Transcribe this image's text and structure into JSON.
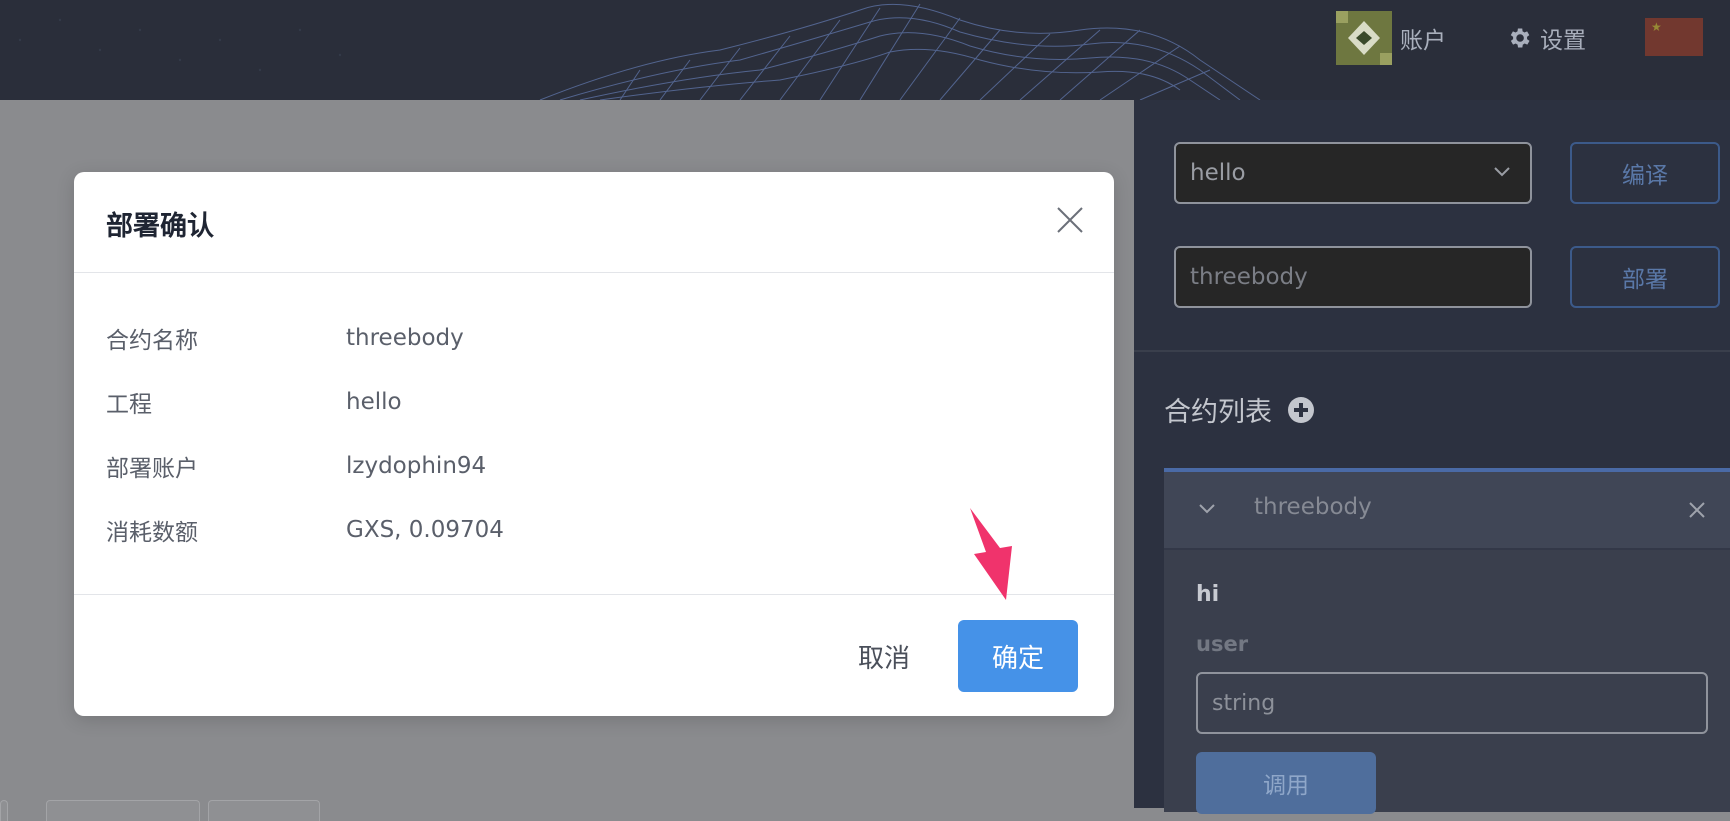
{
  "header": {
    "account_label": "账户",
    "settings_label": "设置"
  },
  "modal": {
    "title": "部署确认",
    "rows": [
      {
        "label": "合约名称",
        "value": "threebody"
      },
      {
        "label": "工程",
        "value": "hello"
      },
      {
        "label": "部署账户",
        "value": "lzydophin94"
      },
      {
        "label": "消耗数额",
        "value": "GXS, 0.09704"
      }
    ],
    "cancel_label": "取消",
    "confirm_label": "确定"
  },
  "right_panel": {
    "project_select_value": "hello",
    "compile_label": "编译",
    "contract_name_input": "threebody",
    "deploy_label": "部署",
    "contract_list_title": "合约列表",
    "contract": {
      "name": "threebody",
      "method_name": "hi",
      "param_label": "user",
      "param_placeholder": "string",
      "call_label": "调用"
    }
  },
  "colors": {
    "header_bg": "#2a2e3a",
    "overlay": "#8a8b8e",
    "panel_bg": "#2c3140",
    "confirm_blue": "#4592e8",
    "arrow_pink": "#f0336c"
  }
}
